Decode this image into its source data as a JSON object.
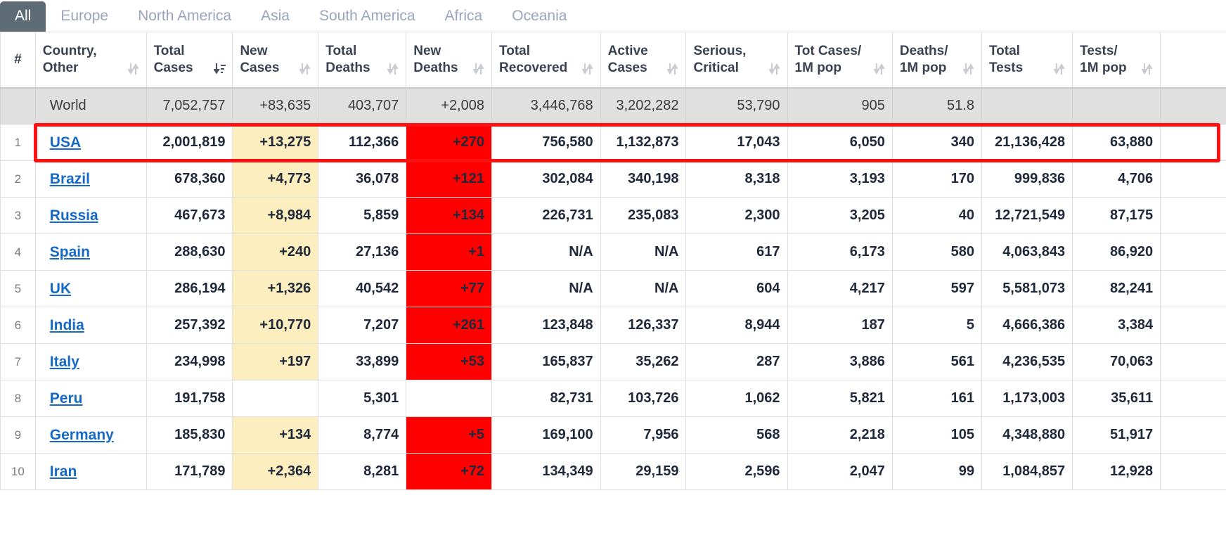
{
  "tabs": [
    {
      "label": "All",
      "active": true
    },
    {
      "label": "Europe",
      "active": false
    },
    {
      "label": "North America",
      "active": false
    },
    {
      "label": "Asia",
      "active": false
    },
    {
      "label": "South America",
      "active": false
    },
    {
      "label": "Africa",
      "active": false
    },
    {
      "label": "Oceania",
      "active": false
    }
  ],
  "columns": [
    {
      "label": "#",
      "sort": "none"
    },
    {
      "label": "Country,\nOther",
      "sort": "both"
    },
    {
      "label": "Total\nCases",
      "sort": "desc-active"
    },
    {
      "label": "New\nCases",
      "sort": "both"
    },
    {
      "label": "Total\nDeaths",
      "sort": "both"
    },
    {
      "label": "New\nDeaths",
      "sort": "both"
    },
    {
      "label": "Total\nRecovered",
      "sort": "both"
    },
    {
      "label": "Active\nCases",
      "sort": "both"
    },
    {
      "label": "Serious,\nCritical",
      "sort": "both"
    },
    {
      "label": "Tot Cases/\n1M pop",
      "sort": "both"
    },
    {
      "label": "Deaths/\n1M pop",
      "sort": "both"
    },
    {
      "label": "Total\nTests",
      "sort": "both"
    },
    {
      "label": "Tests/\n1M pop",
      "sort": "both"
    },
    {
      "label": "",
      "sort": "both"
    }
  ],
  "world_row": {
    "rank": "",
    "country": "World",
    "total_cases": "7,052,757",
    "new_cases": "+83,635",
    "total_deaths": "403,707",
    "new_deaths": "+2,008",
    "total_recovered": "3,446,768",
    "active_cases": "3,202,282",
    "serious_critical": "53,790",
    "tot_cases_1m": "905",
    "deaths_1m": "51.8",
    "total_tests": "",
    "tests_1m": "",
    "extra": ""
  },
  "rows": [
    {
      "rank": "1",
      "country": "USA",
      "total_cases": "2,001,819",
      "new_cases": "+13,275",
      "total_deaths": "112,366",
      "new_deaths": "+270",
      "total_recovered": "756,580",
      "active_cases": "1,132,873",
      "serious_critical": "17,043",
      "tot_cases_1m": "6,050",
      "deaths_1m": "340",
      "total_tests": "21,136,428",
      "tests_1m": "63,880",
      "extra": "",
      "highlighted": true
    },
    {
      "rank": "2",
      "country": "Brazil",
      "total_cases": "678,360",
      "new_cases": "+4,773",
      "total_deaths": "36,078",
      "new_deaths": "+121",
      "total_recovered": "302,084",
      "active_cases": "340,198",
      "serious_critical": "8,318",
      "tot_cases_1m": "3,193",
      "deaths_1m": "170",
      "total_tests": "999,836",
      "tests_1m": "4,706",
      "extra": "",
      "highlighted": false
    },
    {
      "rank": "3",
      "country": "Russia",
      "total_cases": "467,673",
      "new_cases": "+8,984",
      "total_deaths": "5,859",
      "new_deaths": "+134",
      "total_recovered": "226,731",
      "active_cases": "235,083",
      "serious_critical": "2,300",
      "tot_cases_1m": "3,205",
      "deaths_1m": "40",
      "total_tests": "12,721,549",
      "tests_1m": "87,175",
      "extra": "",
      "highlighted": false
    },
    {
      "rank": "4",
      "country": "Spain",
      "total_cases": "288,630",
      "new_cases": "+240",
      "total_deaths": "27,136",
      "new_deaths": "+1",
      "total_recovered": "N/A",
      "active_cases": "N/A",
      "serious_critical": "617",
      "tot_cases_1m": "6,173",
      "deaths_1m": "580",
      "total_tests": "4,063,843",
      "tests_1m": "86,920",
      "extra": "",
      "highlighted": false
    },
    {
      "rank": "5",
      "country": "UK",
      "total_cases": "286,194",
      "new_cases": "+1,326",
      "total_deaths": "40,542",
      "new_deaths": "+77",
      "total_recovered": "N/A",
      "active_cases": "N/A",
      "serious_critical": "604",
      "tot_cases_1m": "4,217",
      "deaths_1m": "597",
      "total_tests": "5,581,073",
      "tests_1m": "82,241",
      "extra": "",
      "highlighted": false
    },
    {
      "rank": "6",
      "country": "India",
      "total_cases": "257,392",
      "new_cases": "+10,770",
      "total_deaths": "7,207",
      "new_deaths": "+261",
      "total_recovered": "123,848",
      "active_cases": "126,337",
      "serious_critical": "8,944",
      "tot_cases_1m": "187",
      "deaths_1m": "5",
      "total_tests": "4,666,386",
      "tests_1m": "3,384",
      "extra": "",
      "highlighted": false
    },
    {
      "rank": "7",
      "country": "Italy",
      "total_cases": "234,998",
      "new_cases": "+197",
      "total_deaths": "33,899",
      "new_deaths": "+53",
      "total_recovered": "165,837",
      "active_cases": "35,262",
      "serious_critical": "287",
      "tot_cases_1m": "3,886",
      "deaths_1m": "561",
      "total_tests": "4,236,535",
      "tests_1m": "70,063",
      "extra": "",
      "highlighted": false
    },
    {
      "rank": "8",
      "country": "Peru",
      "total_cases": "191,758",
      "new_cases": "",
      "total_deaths": "5,301",
      "new_deaths": "",
      "total_recovered": "82,731",
      "active_cases": "103,726",
      "serious_critical": "1,062",
      "tot_cases_1m": "5,821",
      "deaths_1m": "161",
      "total_tests": "1,173,003",
      "tests_1m": "35,611",
      "extra": "",
      "highlighted": false
    },
    {
      "rank": "9",
      "country": "Germany",
      "total_cases": "185,830",
      "new_cases": "+134",
      "total_deaths": "8,774",
      "new_deaths": "+5",
      "total_recovered": "169,100",
      "active_cases": "7,956",
      "serious_critical": "568",
      "tot_cases_1m": "2,218",
      "deaths_1m": "105",
      "total_tests": "4,348,880",
      "tests_1m": "51,917",
      "extra": "",
      "highlighted": false
    },
    {
      "rank": "10",
      "country": "Iran",
      "total_cases": "171,789",
      "new_cases": "+2,364",
      "total_deaths": "8,281",
      "new_deaths": "+72",
      "total_recovered": "134,349",
      "active_cases": "29,159",
      "serious_critical": "2,596",
      "tot_cases_1m": "2,047",
      "deaths_1m": "99",
      "total_tests": "1,084,857",
      "tests_1m": "12,928",
      "extra": "",
      "highlighted": false
    }
  ],
  "colors": {
    "active_tab_bg": "#5d6b74",
    "tab_text": "#9aa4bf",
    "new_cases_bg": "#fceebe",
    "new_deaths_bg": "#ff0000",
    "world_row_bg": "#e0e0e0",
    "link": "#1569c7",
    "highlight_border": "#ff1111"
  }
}
